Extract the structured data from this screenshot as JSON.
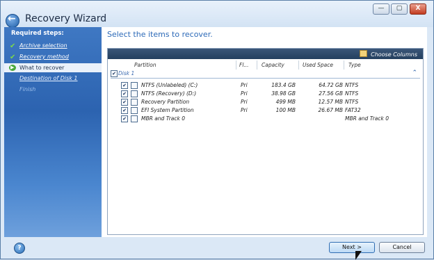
{
  "window": {
    "title": "Recovery Wizard",
    "controls": [
      "—",
      "▢",
      "X"
    ]
  },
  "sidebar": {
    "heading": "Required steps:",
    "steps": [
      {
        "label": "Archive selection",
        "state": "done"
      },
      {
        "label": "Recovery method",
        "state": "done"
      },
      {
        "label": "What to recover",
        "state": "current"
      },
      {
        "label": "Destination of Disk 1",
        "state": "link"
      },
      {
        "label": "Finish",
        "state": "disabled"
      }
    ]
  },
  "main": {
    "heading": "Select the items to recover.",
    "choose_columns": "Choose Columns",
    "columns": [
      "Partition",
      "Fl...",
      "Capacity",
      "Used Space",
      "Type"
    ],
    "group": "Disk 1",
    "rows": [
      {
        "name": "NTFS (Unlabeled) (C:)",
        "flags": "Pri",
        "capacity": "183.4 GB",
        "used": "64.72 GB",
        "type": "NTFS"
      },
      {
        "name": "NTFS (Recovery) (D:)",
        "flags": "Pri",
        "capacity": "38.98 GB",
        "used": "27.56 GB",
        "type": "NTFS"
      },
      {
        "name": "Recovery Partition",
        "flags": "Pri",
        "capacity": "499 MB",
        "used": "12.57 MB",
        "type": "NTFS"
      },
      {
        "name": "EFI System Partition",
        "flags": "Pri",
        "capacity": "100 MB",
        "used": "26.67 MB",
        "type": "FAT32"
      },
      {
        "name": "MBR and Track 0",
        "flags": "",
        "capacity": "",
        "used": "",
        "type": "MBR and Track 0"
      }
    ]
  },
  "footer": {
    "next_label": "Next >",
    "cancel_label": "Cancel"
  },
  "colors": {
    "sidebar": "#2c63b0",
    "heading": "#2d6ab8",
    "header_bar": "#24405f"
  }
}
